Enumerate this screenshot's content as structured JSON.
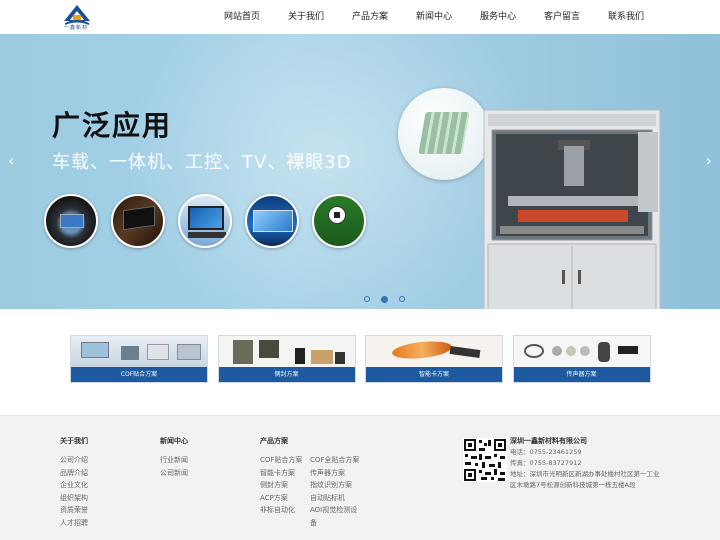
{
  "header": {
    "logo_text": "一鑫新材",
    "nav": [
      "网站首页",
      "关于我们",
      "产品方案",
      "新闻中心",
      "服务中心",
      "客户留言",
      "联系我们"
    ]
  },
  "banner": {
    "title": "广泛应用",
    "subtitle": "车载、一体机、工控、TV、裸眼3D",
    "prev_arrow": "‹",
    "next_arrow": "›",
    "slides": 3,
    "active_slide": 2,
    "circles": [
      "car-dashboard",
      "all-in-one-pc",
      "windows-monitor",
      "tv-display",
      "soccer-3d-tv"
    ]
  },
  "products": [
    {
      "label": "COF贴合方案"
    },
    {
      "label": "侧封方案"
    },
    {
      "label": "智能卡方案"
    },
    {
      "label": "传声器方案"
    }
  ],
  "footer": {
    "about": {
      "title": "关于我们",
      "links": [
        "公司介绍",
        "品牌介绍",
        "企业文化",
        "组织架构",
        "资质荣誉",
        "人才招聘"
      ]
    },
    "news": {
      "title": "新闻中心",
      "links": [
        "行业新闻",
        "公司新闻"
      ]
    },
    "solutions": {
      "title": "产品方案",
      "col1": [
        "COF贴合方案",
        "智能卡方案",
        "侧封方案",
        "ACP方案",
        "非标自动化"
      ],
      "col2": [
        "COF全贴合方案",
        "传声器方案",
        "指纹识别方案",
        "自动贴标机",
        "AOI视觉检测设",
        "备"
      ]
    },
    "contact": {
      "company": "深圳一鑫新材料有限公司",
      "phone": "电话：0755-23461259",
      "fax": "传真：0755-83727912",
      "address": "地址：深圳市光明新区新湖办事处楼村社区第一工业区木墩路7号松源创新科技城第一栋五楼A段"
    }
  },
  "colors": {
    "accent": "#1e5aa0",
    "banner": "#a8d3e8",
    "footer_bg": "#f2f2f2"
  }
}
